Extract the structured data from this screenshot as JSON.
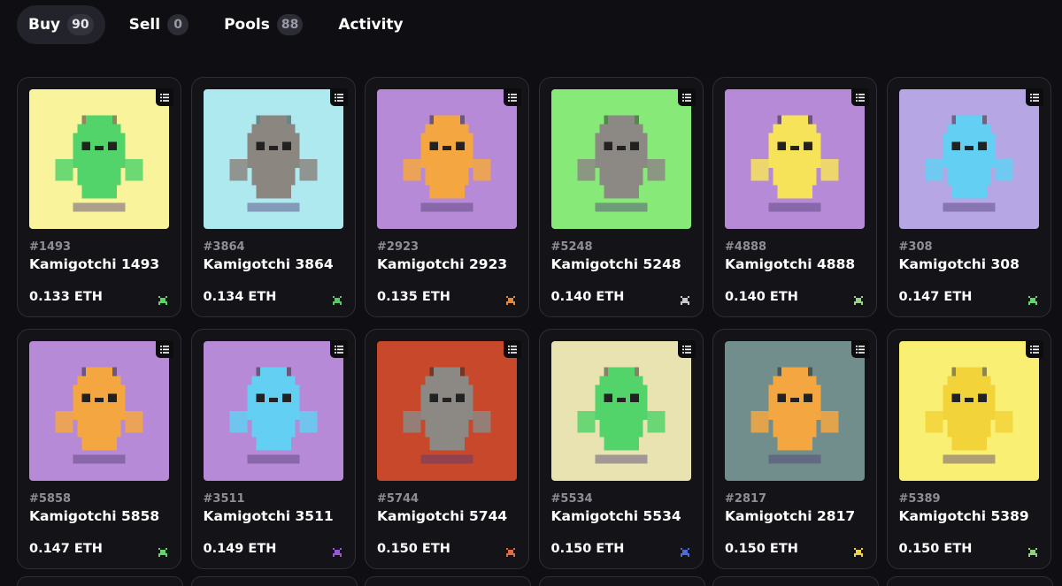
{
  "tabs": [
    {
      "label": "Buy",
      "count": "90",
      "active": true
    },
    {
      "label": "Sell",
      "count": "0",
      "active": false
    },
    {
      "label": "Pools",
      "count": "88",
      "active": false
    },
    {
      "label": "Activity",
      "count": null,
      "active": false
    }
  ],
  "cards": [
    {
      "id": "#1493",
      "name": "Kamigotchi 1493",
      "price": "0.133 ETH",
      "bg": "#f9f39b",
      "body": "#53d46b",
      "trait_color": "#5ad368"
    },
    {
      "id": "#3864",
      "name": "Kamigotchi 3864",
      "price": "0.134 ETH",
      "bg": "#aee9ef",
      "body": "#8b8680",
      "trait_color": "#58c86a"
    },
    {
      "id": "#2923",
      "name": "Kamigotchi 2923",
      "price": "0.135 ETH",
      "bg": "#b68ad6",
      "body": "#f4a741",
      "trait_color": "#e2873e"
    },
    {
      "id": "#5248",
      "name": "Kamigotchi 5248",
      "price": "0.140 ETH",
      "bg": "#87ea78",
      "body": "#8c8884",
      "trait_color": "#c9c9c9"
    },
    {
      "id": "#4888",
      "name": "Kamigotchi 4888",
      "price": "0.140 ETH",
      "bg": "#b68ad6",
      "body": "#f6e35a",
      "trait_color": "#9ad08a"
    },
    {
      "id": "#308",
      "name": "Kamigotchi 308",
      "price": "0.147 ETH",
      "bg": "#b6a6e4",
      "body": "#63cff2",
      "trait_color": "#63d56a"
    },
    {
      "id": "#5858",
      "name": "Kamigotchi 5858",
      "price": "0.147 ETH",
      "bg": "#b68ad6",
      "body": "#f4a741",
      "trait_color": "#63d56a"
    },
    {
      "id": "#3511",
      "name": "Kamigotchi 3511",
      "price": "0.149 ETH",
      "bg": "#b68ad6",
      "body": "#63cff2",
      "trait_color": "#9a56d9"
    },
    {
      "id": "#5744",
      "name": "Kamigotchi 5744",
      "price": "0.150 ETH",
      "bg": "#c8482c",
      "body": "#8c8884",
      "trait_color": "#e36a3d"
    },
    {
      "id": "#5534",
      "name": "Kamigotchi 5534",
      "price": "0.150 ETH",
      "bg": "#e8e3b0",
      "body": "#53d46b",
      "trait_color": "#4d6bd9"
    },
    {
      "id": "#2817",
      "name": "Kamigotchi 2817",
      "price": "0.150 ETH",
      "bg": "#718e8c",
      "body": "#f4a741",
      "trait_color": "#f1d04a"
    },
    {
      "id": "#5389",
      "name": "Kamigotchi 5389",
      "price": "0.150 ETH",
      "bg": "#f9ef72",
      "body": "#f2d43a",
      "trait_color": "#8fd27a"
    }
  ]
}
